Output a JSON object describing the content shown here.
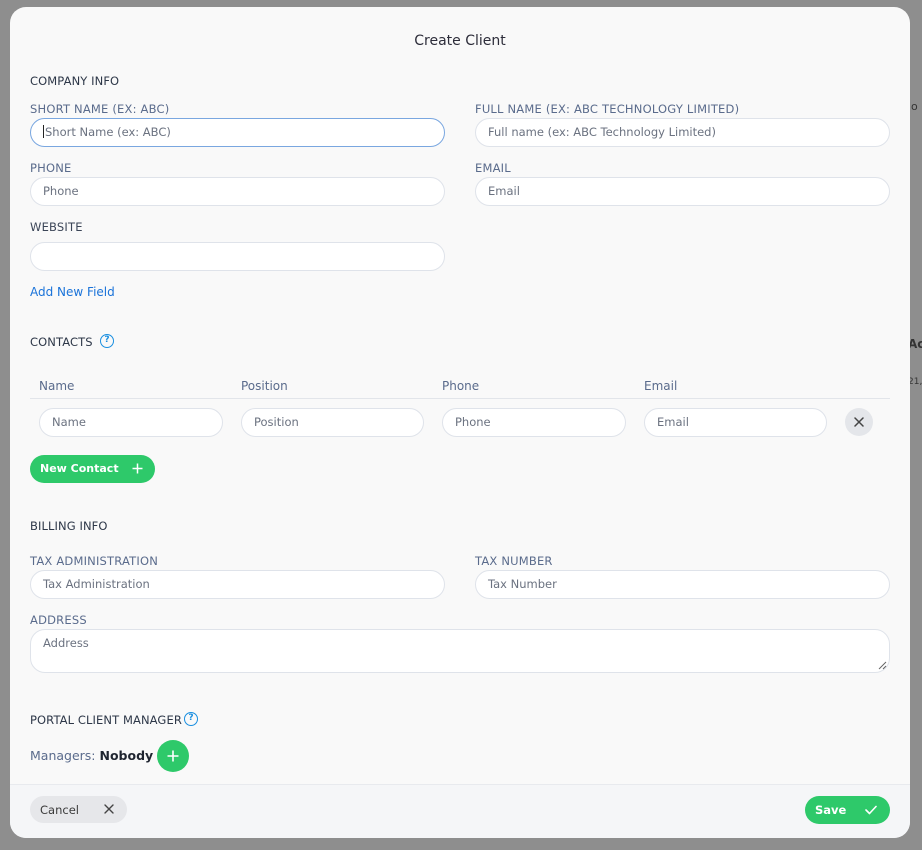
{
  "modal": {
    "title": "Create Client"
  },
  "company_info": {
    "section_title": "COMPANY INFO",
    "short_name": {
      "label": "SHORT NAME (EX: ABC)",
      "placeholder": "Short Name (ex: ABC)"
    },
    "full_name": {
      "label": "FULL NAME (EX: ABC TECHNOLOGY LIMITED)",
      "placeholder": "Full name (ex: ABC Technology Limited)"
    },
    "phone": {
      "label": "PHONE",
      "placeholder": "Phone"
    },
    "email": {
      "label": "EMAIL",
      "placeholder": "Email"
    },
    "website": {
      "label": "WEBSITE",
      "value": ""
    },
    "add_field_label": "Add New Field"
  },
  "contacts": {
    "section_title": "CONTACTS",
    "help_icon": "?",
    "columns": [
      "Name",
      "Position",
      "Phone",
      "Email"
    ],
    "row": {
      "name_placeholder": "Name",
      "position_placeholder": "Position",
      "phone_placeholder": "Phone",
      "email_placeholder": "Email",
      "remove_icon": "close-icon"
    },
    "new_contact_label": "New Contact"
  },
  "billing_info": {
    "section_title": "BILLING INFO",
    "tax_administration": {
      "label": "TAX ADMINISTRATION",
      "placeholder": "Tax Administration"
    },
    "tax_number": {
      "label": "TAX NUMBER",
      "placeholder": "Tax Number"
    },
    "address": {
      "label": "ADDRESS",
      "placeholder": "Address"
    }
  },
  "portal_client_manager": {
    "section_title": "PORTAL CLIENT MANAGER",
    "help_icon": "?",
    "managers_label": "Managers:",
    "managers_value": "Nobody"
  },
  "footer": {
    "cancel_label": "Cancel",
    "save_label": "Save"
  },
  "background": {
    "peek_1": "lo",
    "peek_2": "Ac",
    "peek_3": "21,"
  },
  "colors": {
    "accent_green": "#2ec96a",
    "link_blue": "#1a73d9",
    "label_gray": "#5a6b8c"
  }
}
